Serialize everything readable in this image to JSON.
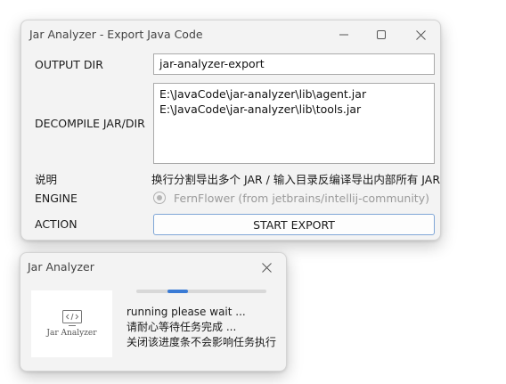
{
  "main_window": {
    "title": "Jar Analyzer - Export Java Code",
    "output_dir_label": "OUTPUT DIR",
    "output_dir_value": "jar-analyzer-export",
    "decompile_label": "DECOMPILE JAR/DIR",
    "jar_paths": [
      "E:\\JavaCode\\jar-analyzer\\lib\\agent.jar",
      "E:\\JavaCode\\jar-analyzer\\lib\\tools.jar"
    ],
    "description_label": "说明",
    "description_text": "换行分割导出多个 JAR / 输入目录反编译导出内部所有 JAR",
    "engine_label": "ENGINE",
    "engine_option": "FernFlower (from jetbrains/intellij-community)",
    "engine_selected": true,
    "action_label": "ACTION",
    "start_button": "START EXPORT"
  },
  "progress_window": {
    "title": "Jar Analyzer",
    "logo_text": "Jar Analyzer",
    "progress_fill": 0.16,
    "progress_offset": 0.24,
    "messages": [
      "running please wait ...",
      "请耐心等待任务完成 ...",
      "关闭该进度条不会影响任务执行"
    ]
  },
  "icons": [
    "minimize-icon",
    "maximize-icon",
    "close-icon",
    "radio-icon",
    "code-icon"
  ],
  "colors": {
    "accent": "#3a7bd5",
    "window_bg": "#f3f3f3",
    "button_border": "#7fa6d6"
  }
}
